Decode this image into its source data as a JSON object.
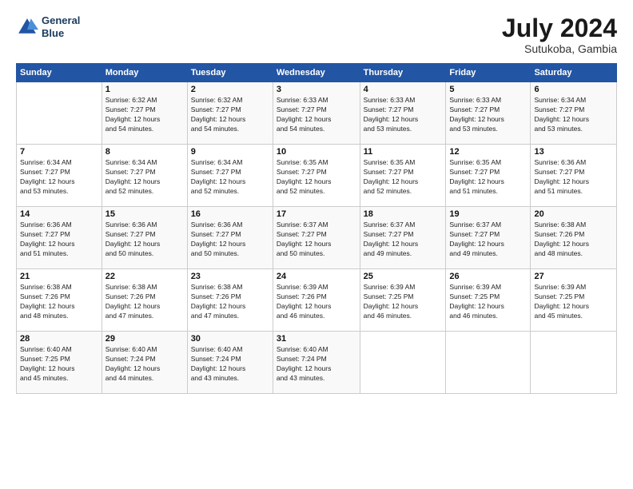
{
  "header": {
    "logo_line1": "General",
    "logo_line2": "Blue",
    "month": "July 2024",
    "location": "Sutukoba, Gambia"
  },
  "weekdays": [
    "Sunday",
    "Monday",
    "Tuesday",
    "Wednesday",
    "Thursday",
    "Friday",
    "Saturday"
  ],
  "weeks": [
    [
      {
        "day": "",
        "info": ""
      },
      {
        "day": "1",
        "info": "Sunrise: 6:32 AM\nSunset: 7:27 PM\nDaylight: 12 hours\nand 54 minutes."
      },
      {
        "day": "2",
        "info": "Sunrise: 6:32 AM\nSunset: 7:27 PM\nDaylight: 12 hours\nand 54 minutes."
      },
      {
        "day": "3",
        "info": "Sunrise: 6:33 AM\nSunset: 7:27 PM\nDaylight: 12 hours\nand 54 minutes."
      },
      {
        "day": "4",
        "info": "Sunrise: 6:33 AM\nSunset: 7:27 PM\nDaylight: 12 hours\nand 53 minutes."
      },
      {
        "day": "5",
        "info": "Sunrise: 6:33 AM\nSunset: 7:27 PM\nDaylight: 12 hours\nand 53 minutes."
      },
      {
        "day": "6",
        "info": "Sunrise: 6:34 AM\nSunset: 7:27 PM\nDaylight: 12 hours\nand 53 minutes."
      }
    ],
    [
      {
        "day": "7",
        "info": "Sunrise: 6:34 AM\nSunset: 7:27 PM\nDaylight: 12 hours\nand 53 minutes."
      },
      {
        "day": "8",
        "info": "Sunrise: 6:34 AM\nSunset: 7:27 PM\nDaylight: 12 hours\nand 52 minutes."
      },
      {
        "day": "9",
        "info": "Sunrise: 6:34 AM\nSunset: 7:27 PM\nDaylight: 12 hours\nand 52 minutes."
      },
      {
        "day": "10",
        "info": "Sunrise: 6:35 AM\nSunset: 7:27 PM\nDaylight: 12 hours\nand 52 minutes."
      },
      {
        "day": "11",
        "info": "Sunrise: 6:35 AM\nSunset: 7:27 PM\nDaylight: 12 hours\nand 52 minutes."
      },
      {
        "day": "12",
        "info": "Sunrise: 6:35 AM\nSunset: 7:27 PM\nDaylight: 12 hours\nand 51 minutes."
      },
      {
        "day": "13",
        "info": "Sunrise: 6:36 AM\nSunset: 7:27 PM\nDaylight: 12 hours\nand 51 minutes."
      }
    ],
    [
      {
        "day": "14",
        "info": "Sunrise: 6:36 AM\nSunset: 7:27 PM\nDaylight: 12 hours\nand 51 minutes."
      },
      {
        "day": "15",
        "info": "Sunrise: 6:36 AM\nSunset: 7:27 PM\nDaylight: 12 hours\nand 50 minutes."
      },
      {
        "day": "16",
        "info": "Sunrise: 6:36 AM\nSunset: 7:27 PM\nDaylight: 12 hours\nand 50 minutes."
      },
      {
        "day": "17",
        "info": "Sunrise: 6:37 AM\nSunset: 7:27 PM\nDaylight: 12 hours\nand 50 minutes."
      },
      {
        "day": "18",
        "info": "Sunrise: 6:37 AM\nSunset: 7:27 PM\nDaylight: 12 hours\nand 49 minutes."
      },
      {
        "day": "19",
        "info": "Sunrise: 6:37 AM\nSunset: 7:27 PM\nDaylight: 12 hours\nand 49 minutes."
      },
      {
        "day": "20",
        "info": "Sunrise: 6:38 AM\nSunset: 7:26 PM\nDaylight: 12 hours\nand 48 minutes."
      }
    ],
    [
      {
        "day": "21",
        "info": "Sunrise: 6:38 AM\nSunset: 7:26 PM\nDaylight: 12 hours\nand 48 minutes."
      },
      {
        "day": "22",
        "info": "Sunrise: 6:38 AM\nSunset: 7:26 PM\nDaylight: 12 hours\nand 47 minutes."
      },
      {
        "day": "23",
        "info": "Sunrise: 6:38 AM\nSunset: 7:26 PM\nDaylight: 12 hours\nand 47 minutes."
      },
      {
        "day": "24",
        "info": "Sunrise: 6:39 AM\nSunset: 7:26 PM\nDaylight: 12 hours\nand 46 minutes."
      },
      {
        "day": "25",
        "info": "Sunrise: 6:39 AM\nSunset: 7:25 PM\nDaylight: 12 hours\nand 46 minutes."
      },
      {
        "day": "26",
        "info": "Sunrise: 6:39 AM\nSunset: 7:25 PM\nDaylight: 12 hours\nand 46 minutes."
      },
      {
        "day": "27",
        "info": "Sunrise: 6:39 AM\nSunset: 7:25 PM\nDaylight: 12 hours\nand 45 minutes."
      }
    ],
    [
      {
        "day": "28",
        "info": "Sunrise: 6:40 AM\nSunset: 7:25 PM\nDaylight: 12 hours\nand 45 minutes."
      },
      {
        "day": "29",
        "info": "Sunrise: 6:40 AM\nSunset: 7:24 PM\nDaylight: 12 hours\nand 44 minutes."
      },
      {
        "day": "30",
        "info": "Sunrise: 6:40 AM\nSunset: 7:24 PM\nDaylight: 12 hours\nand 43 minutes."
      },
      {
        "day": "31",
        "info": "Sunrise: 6:40 AM\nSunset: 7:24 PM\nDaylight: 12 hours\nand 43 minutes."
      },
      {
        "day": "",
        "info": ""
      },
      {
        "day": "",
        "info": ""
      },
      {
        "day": "",
        "info": ""
      }
    ]
  ]
}
